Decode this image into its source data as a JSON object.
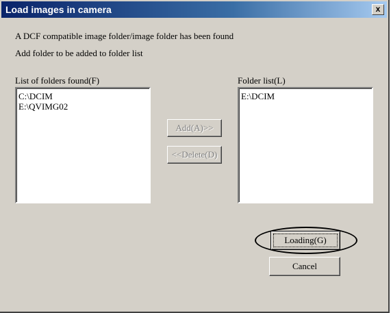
{
  "window": {
    "title": "Load images in camera",
    "close_label": "x"
  },
  "messages": {
    "line1": "A DCF compatible image folder/image folder has been found",
    "line2": "Add folder to be added to folder list"
  },
  "found_list": {
    "label": "List of folders found(F)",
    "items": [
      "C:\\DCIM",
      "E:\\QVIMG02"
    ]
  },
  "folder_list": {
    "label": "Folder list(L)",
    "items": [
      "E:\\DCIM"
    ]
  },
  "buttons": {
    "add": "Add(A)>>",
    "delete": "<<Delete(D)",
    "loading": "Loading(G)",
    "cancel": "Cancel"
  }
}
